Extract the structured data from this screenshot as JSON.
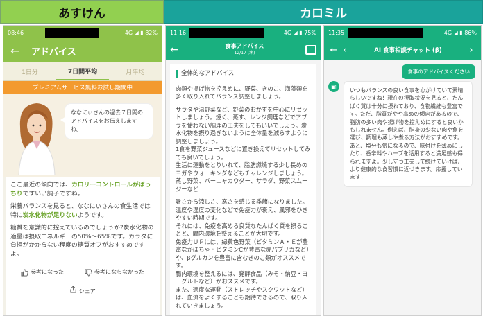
{
  "headers": {
    "asuken": "あすけん",
    "karomiru": "カロミル"
  },
  "phone1": {
    "status_time": "08:46",
    "status_right": "4G ◢ ▮ 82%",
    "title": "アドバイス",
    "tabs": [
      {
        "label": "1日分",
        "active": false
      },
      {
        "label": "7日間平均",
        "active": true
      },
      {
        "label": "月平均",
        "active": false
      }
    ],
    "promo": "プレミアムサービス無料お試し期間中",
    "bubble": "ななにぃさんの過去７日間のアドバイスをお伝えしますね。",
    "para1_pre": "ここ最近の傾向では、",
    "para1_hl": "カロリーコントロールがばっちり",
    "para1_post": "ですいい調子ですね。",
    "para2_pre": "栄養バランスを見ると、ななにぃさんの食生活では特に",
    "para2_hl": "炭水化物が足りない",
    "para2_post": "ようです。",
    "para3": "糖質を意識的に控えているのでしょうか?炭水化物の適量は摂取エネルギーの50%～65%です。カラダに負担がかからない程度の糖質オフがおすすめですよ。",
    "btn_good": "参考になった",
    "btn_bad": "参考にならなかった",
    "btn_share": "シェア"
  },
  "phone2": {
    "status_time": "11:16",
    "status_right": "4G ◢ ▮ 75%",
    "title": "食事アドバイス",
    "date": "12/17 (水)",
    "section": "全体的なアドバイス",
    "paragraphs": [
      "肉類や揚げ物を控えめに、野菜、きのこ、海藻類を多く取り入れてバランス調整しましょう。",
      "サラダや温野菜など、野菜のおかずを中心にリセットしましょう。焼く、蒸す、レンジ調理などでアブラを使わない調理の工夫をしてもいいでしょう。炭水化物を摂り過ぎないように全体量を減らすように調整しましょう。\n1食を野菜ジュースなどに置き換えてリセットしてみても良いでしょう。\n生活に運動をとりいれて、脂肪燃焼する少し長めのヨガやウォーキングなどもチャレンジしましょう。\n蒸し野菜、バーニャカウダー、サラダ、野菜スムージーなど",
      "暑さから涼しさ、寒さを感じる季節になりました。温度や湿度の変化などで免疫力が衰え、風邪をひきやすい時期です。\nそれには、免疫を高める良質なたんぱく質を摂ることと、腸内環境を整えることが大切です。\n免疫力ＵＰには、緑黄色野菜（ビタミンＡ・Ｅが豊富なかぼちゃ・ビタミンCが豊富な赤パプリカなど）や、βグルカンを豊富に含むきのこ類がオススメです。\n腸内環境を整えるには、発酵食品（みそ・納豆・ヨーグルトなど）がおススメです。\nまた、適度な運動（ストレッチやスクワットなど）は、血流をよくすることも期待できるので、取り入れていきましょう。"
    ]
  },
  "phone3": {
    "status_time": "11:35",
    "status_right": "4G ◢ ▮ 86%",
    "title": "AI 食事相談チャット (β)",
    "user_msg": "食事のアドバイスください",
    "bot_msg": "いつもバランスの良い食事を心がけていて素晴らしいですね！現在の摂取状況を見ると、たんぱく質は十分に摂れており、食物繊維も豊富です。ただ、脂質がやや高めの傾向があるので、脂肪の多い肉や揚げ物を控えめにすると良いかもしれません。例えば、脂身の少ない肉や魚を選び、調理も蒸しや煮る方法がおすすめです。あと、塩分も気になるので、味付けを薄めにしたり、香辛料やハーブを活用すると満足感も得られますよ。少しずつ工夫して続けていけば、より健康的な食習慣に近づきます。応援しています！"
  }
}
